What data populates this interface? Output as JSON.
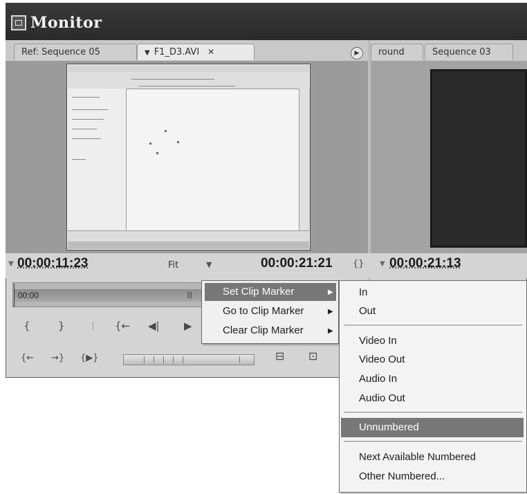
{
  "window": {
    "title": "Monitor"
  },
  "tabs": {
    "source": [
      {
        "label": "Ref: Sequence 05"
      },
      {
        "label": "F1_D3.AVI",
        "close": "✕",
        "menu_icon": "▼"
      }
    ],
    "program": [
      {
        "label": "round"
      },
      {
        "label": "Sequence 03"
      }
    ]
  },
  "source": {
    "timecode": "00:00:11:23",
    "zoom": "Fit",
    "duration": "00:00:21:21",
    "ruler_label": "00:00"
  },
  "program": {
    "timecode": "00:00:21:13"
  },
  "context_menu": {
    "items": [
      {
        "label": "Set Clip Marker",
        "highlighted": true,
        "has_submenu": true
      },
      {
        "label": "Go to Clip Marker",
        "has_submenu": true
      },
      {
        "label": "Clear Clip Marker",
        "has_submenu": true
      }
    ]
  },
  "submenu": {
    "groups": [
      [
        "In",
        "Out"
      ],
      [
        "Video In",
        "Video Out",
        "Audio In",
        "Audio Out"
      ],
      [
        "Unnumbered"
      ],
      [
        "Next Available Numbered",
        "Other Numbered..."
      ]
    ],
    "highlighted": "Unnumbered"
  },
  "colors": {
    "titlebar": "#2a2a2a",
    "menu_highlight": "#777777",
    "panel_bg": "#d4d4d4"
  }
}
